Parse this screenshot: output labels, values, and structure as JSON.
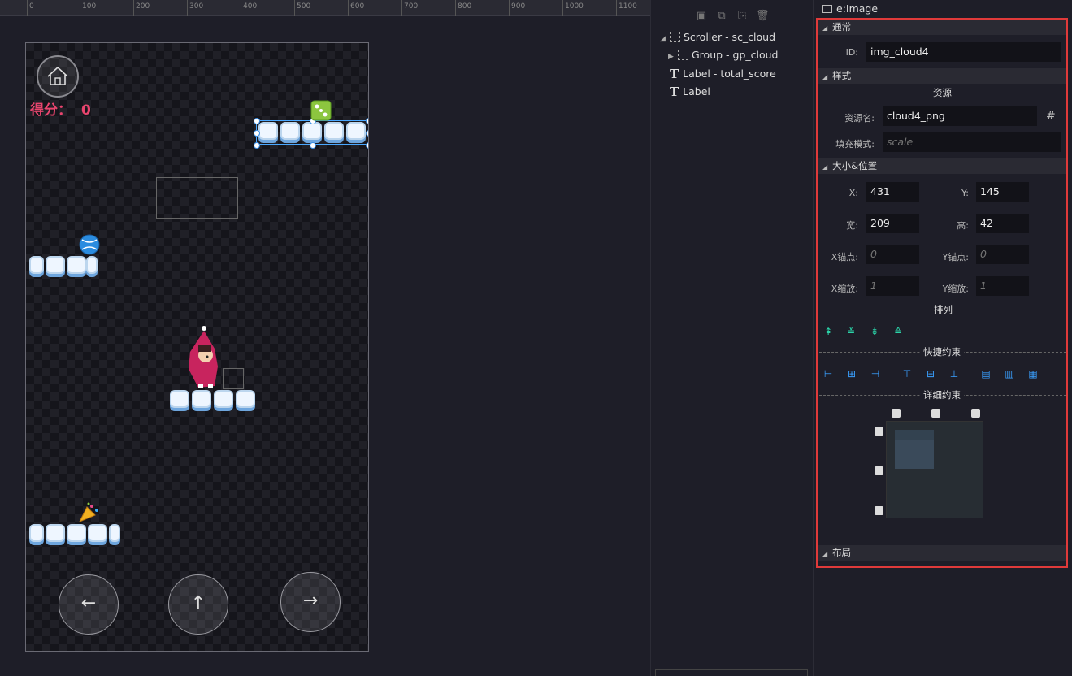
{
  "ruler": {
    "ticks": [
      "0",
      "100",
      "200",
      "300",
      "400",
      "500",
      "600",
      "700",
      "800",
      "900",
      "1000",
      "1100"
    ]
  },
  "game": {
    "score_label": "得分：",
    "score_value": "0",
    "btn_left": "←",
    "btn_up": "↑",
    "btn_right": "→"
  },
  "toolbar": {
    "icons": [
      "group-icon",
      "ungroup-icon",
      "copy-icon",
      "trash-icon"
    ]
  },
  "tree": {
    "scroller": "Scroller - sc_cloud",
    "group": "Group - gp_cloud",
    "label_total": "Label - total_score",
    "label": "Label"
  },
  "inspector": {
    "type": "e:Image",
    "sec_common": "通常",
    "id_label": "ID:",
    "id_value": "img_cloud4",
    "sec_style": "样式",
    "res_header": "资源",
    "res_name_label": "资源名:",
    "res_name_value": "cloud4_png",
    "fill_label": "填充模式:",
    "fill_placeholder": "scale",
    "sec_size": "大小&位置",
    "x_label": "X:",
    "x_value": "431",
    "y_label": "Y:",
    "y_value": "145",
    "w_label": "宽:",
    "w_value": "209",
    "h_label": "高:",
    "h_value": "42",
    "ax_label": "X锚点:",
    "ax_placeholder": "0",
    "ay_label": "Y锚点:",
    "ay_placeholder": "0",
    "sx_label": "X缩放:",
    "sx_placeholder": "1",
    "sy_label": "Y缩放:",
    "sy_placeholder": "1",
    "arrange": "排列",
    "quick": "快捷约束",
    "detail": "详细约束",
    "sec_layout": "布局"
  },
  "colors": {
    "accent": "#e03a3a",
    "score": "#e8456e",
    "selection": "#4aa8ff",
    "icon_green": "#2bd3a8",
    "icon_blue": "#3aa0ff"
  }
}
